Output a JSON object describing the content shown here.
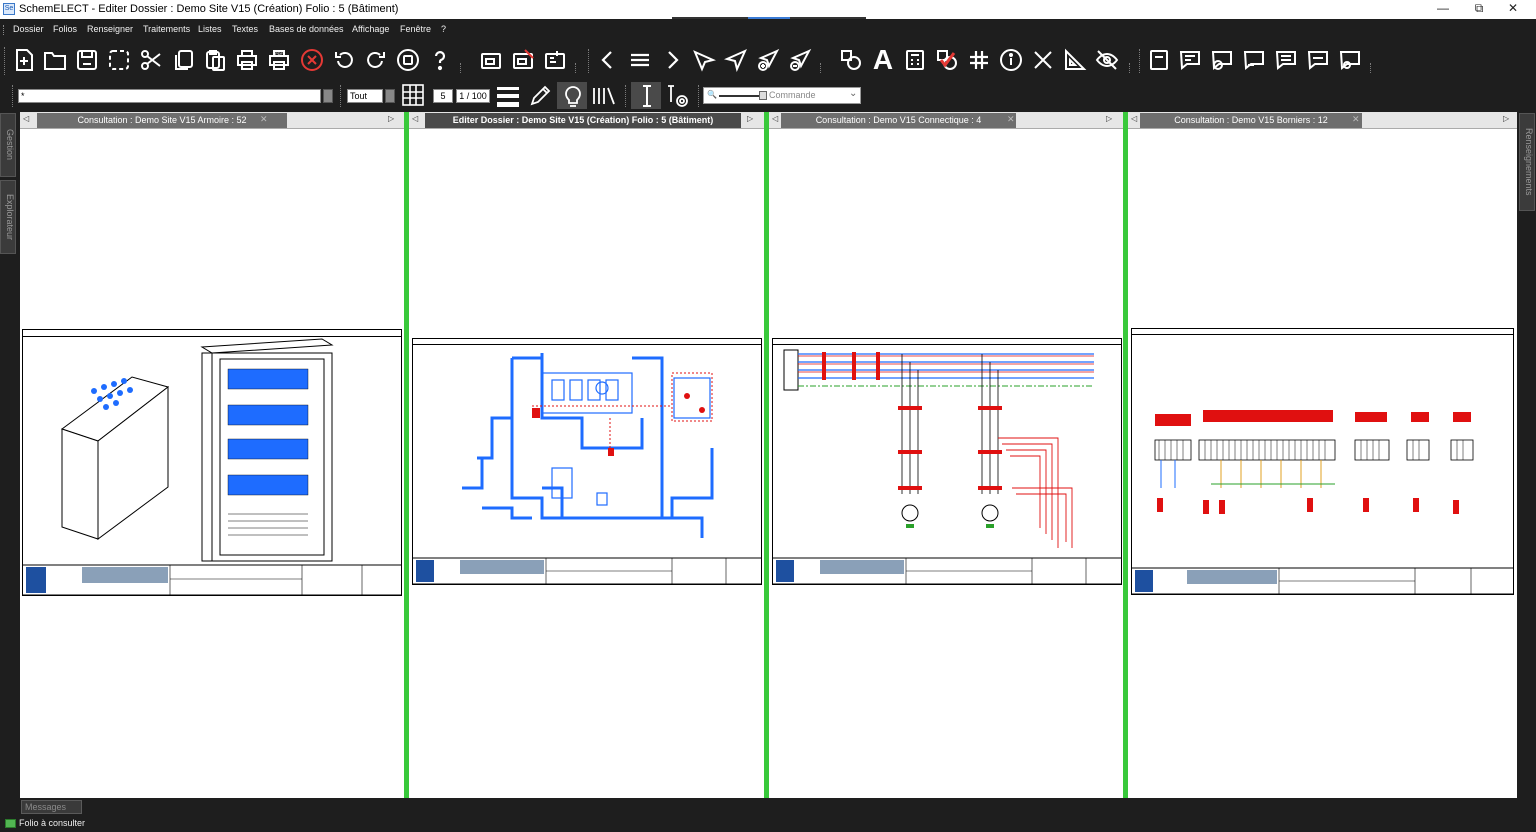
{
  "window": {
    "app_icon": "schemelect-app-icon",
    "title": "SchemELECT - Editer  Dossier : Demo Site V15  (Création)  Folio : 5  (Bâtiment)",
    "minimize": "—",
    "restore": "⧉",
    "close": "✕"
  },
  "menu": {
    "items": [
      "Dossier",
      "Folios",
      "Renseigner",
      "Traitements",
      "Listes",
      "Textes",
      "Bases de données",
      "Affichage",
      "Fenêtre",
      "?"
    ]
  },
  "toolbar": {
    "icons": [
      "new-file-icon",
      "open-folder-icon",
      "save-icon",
      "select-area-icon",
      "cut-icon",
      "copy-icon",
      "paste-icon",
      "print-icon",
      "pdf-icon",
      "cancel-icon",
      "undo-icon",
      "redo-icon",
      "stop-icon",
      "help-icon",
      "folio-icon",
      "folio-delete-icon",
      "folio-attributes-icon",
      "previous-icon",
      "menu-icon",
      "next-icon",
      "pointer-icon",
      "navigate-icon",
      "send-add-icon",
      "send-remove-icon",
      "shapes-icon",
      "text-icon",
      "calculator-icon",
      "validate-icon",
      "grid-hash-icon",
      "info-icon",
      "close-x-icon",
      "measure-icon",
      "hide-icon",
      "document-icon",
      "comment-1-icon",
      "comment-2-icon",
      "comment-3-icon",
      "comment-4-icon",
      "comment-5-icon",
      "comment-6-icon"
    ]
  },
  "toolbar2": {
    "search_value": "*",
    "filter_value": "Tout",
    "grid_value": "5",
    "scale_value": "1 / 100",
    "command_placeholder": "Commande",
    "icons": [
      "grid-icon",
      "line-weight-icon",
      "pencil-icon",
      "bulb-icon",
      "cable-bundle-icon",
      "insert-cursor-icon",
      "settings-icon",
      "zoom-icon"
    ]
  },
  "panels": [
    {
      "tab": "Consultation : Demo Site V15  Armoire : 52",
      "active": false,
      "close": "✕"
    },
    {
      "tab": "Editer  Dossier : Demo Site V15  (Création)  Folio : 5  (Bâtiment)",
      "active": true,
      "close": ""
    },
    {
      "tab": "Consultation : Demo V15  Connectique : 4",
      "active": false,
      "close": "✕"
    },
    {
      "tab": "Consultation : Demo V15  Borniers : 12",
      "active": false,
      "close": "✕"
    }
  ],
  "side_tabs": {
    "left": [
      "Gestion",
      "Explorateur"
    ],
    "right": [
      "Renseignements"
    ]
  },
  "status": {
    "messages_label": "Messages",
    "status_text": "Folio à consulter",
    "status_icon": "folio-status-icon"
  },
  "colors": {
    "background": "#1e1e1e",
    "active_divider": "#39c93b",
    "drawing_blue": "#1e6cff",
    "drawing_red": "#e01010",
    "drawing_black": "#000000"
  }
}
